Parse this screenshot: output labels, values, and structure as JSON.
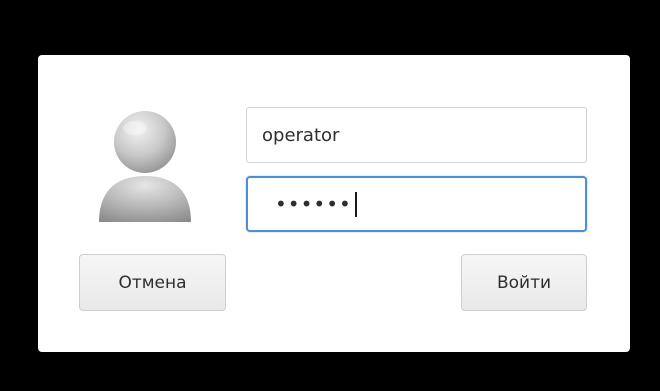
{
  "login_form": {
    "username_value": "operator",
    "password_value": "••••••",
    "cancel_label": "Отмена",
    "submit_label": "Войти",
    "avatar_icon": "user-silhouette-icon",
    "focus_color": "#4a90d9"
  }
}
